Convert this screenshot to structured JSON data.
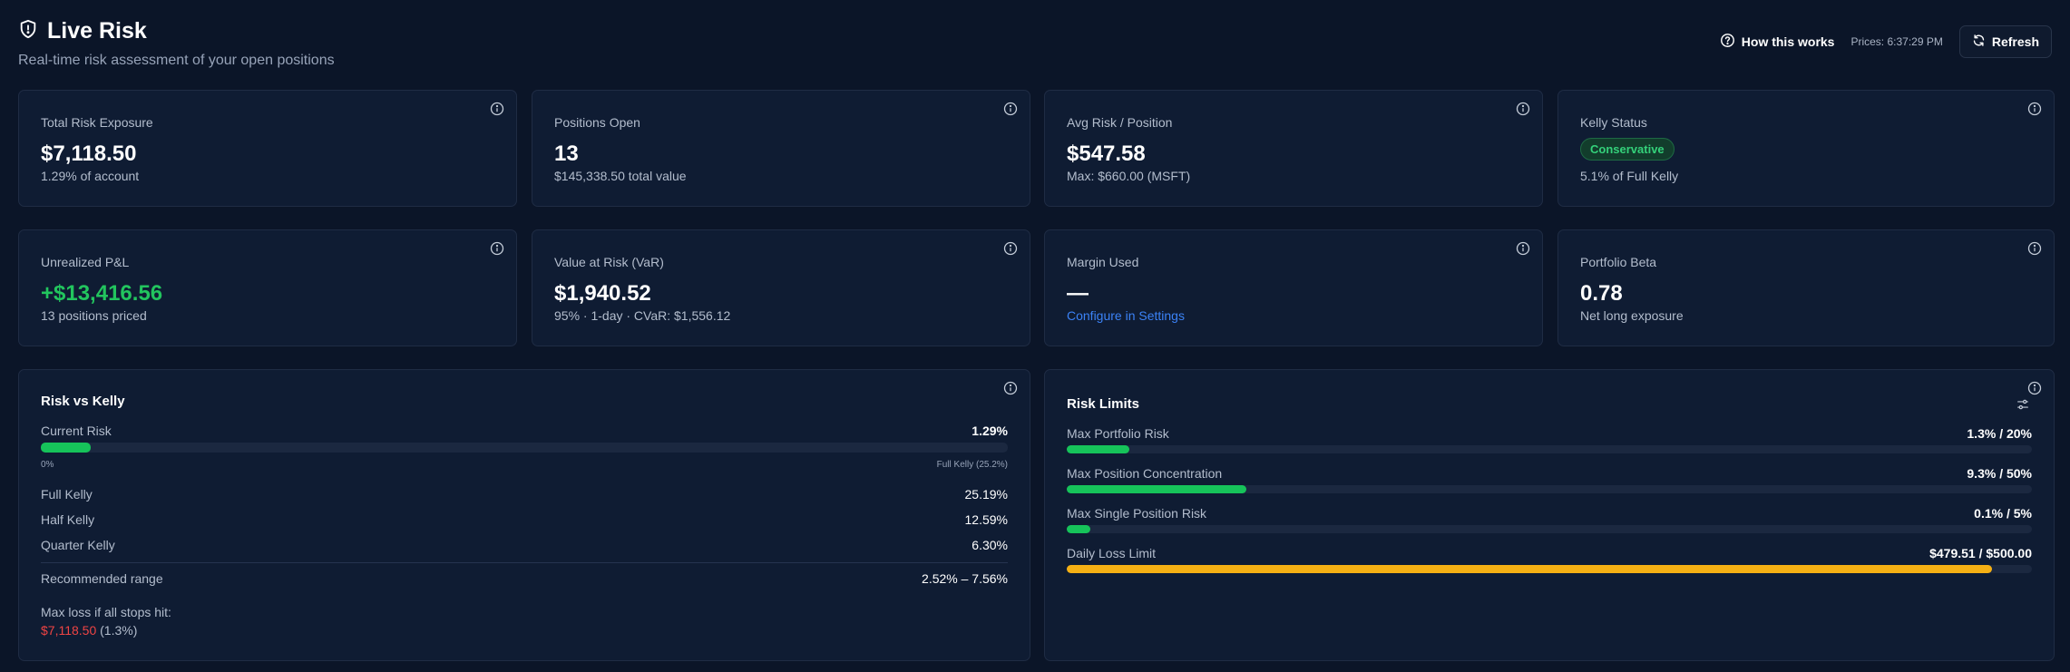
{
  "header": {
    "title": "Live Risk",
    "subtitle": "Real-time risk assessment of your open positions",
    "how_label": "How this works",
    "prices_label": "Prices: 6:37:29 PM",
    "refresh_label": "Refresh"
  },
  "stats": [
    {
      "label": "Total Risk Exposure",
      "value": "$7,118.50",
      "sub": "1.29% of account"
    },
    {
      "label": "Positions Open",
      "value": "13",
      "sub": "$145,338.50 total value"
    },
    {
      "label": "Avg Risk / Position",
      "value": "$547.58",
      "sub": "Max: $660.00 (MSFT)"
    },
    {
      "label": "Kelly Status",
      "badge": "Conservative",
      "sub": "5.1% of Full Kelly"
    },
    {
      "label": "Unrealized P&L",
      "value": "+$13,416.56",
      "sub": "13 positions priced"
    },
    {
      "label": "Value at Risk (VaR)",
      "value": "$1,940.52",
      "sub": "95% · 1-day · CVaR: $1,556.12"
    },
    {
      "label": "Margin Used",
      "value": "—",
      "sub": "Configure in Settings"
    },
    {
      "label": "Portfolio Beta",
      "value": "0.78",
      "sub": "Net long exposure"
    }
  ],
  "kelly_panel": {
    "title": "Risk vs Kelly",
    "current_label": "Current Risk",
    "current_value": "1.29%",
    "current_fraction": 0.0512,
    "axis_min": "0%",
    "axis_max": "Full Kelly (25.2%)",
    "rows": [
      {
        "label": "Full Kelly",
        "value": "25.19%"
      },
      {
        "label": "Half Kelly",
        "value": "12.59%"
      },
      {
        "label": "Quarter Kelly",
        "value": "6.30%"
      }
    ],
    "recommended_label": "Recommended range",
    "recommended_value": "2.52% – 7.56%",
    "maxloss_label": "Max loss if all stops hit:",
    "maxloss_value": "$7,118.50",
    "maxloss_pct": "(1.3%)"
  },
  "limits_panel": {
    "title": "Risk Limits",
    "limits": [
      {
        "label": "Max Portfolio Risk",
        "value": "1.3% / 20%",
        "fraction": 0.065,
        "color": "#16c35a"
      },
      {
        "label": "Max Position Concentration",
        "value": "9.3% / 50%",
        "fraction": 0.186,
        "color": "#16c35a"
      },
      {
        "label": "Max Single Position Risk",
        "value": "0.1% / 5%",
        "fraction": 0.024,
        "color": "#16c35a"
      },
      {
        "label": "Daily Loss Limit",
        "value": "$479.51 / $500.00",
        "fraction": 0.959,
        "color": "#f5b014"
      }
    ]
  },
  "colors": {
    "accent_green": "#22c55e",
    "accent_amber": "#f5b014",
    "accent_blue": "#3b82f6",
    "accent_red": "#ef4444"
  }
}
